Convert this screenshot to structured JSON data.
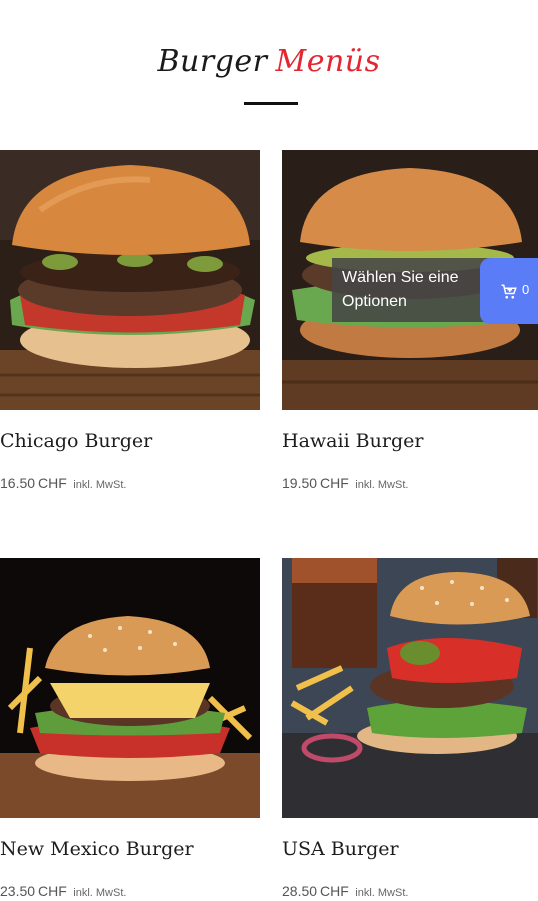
{
  "heading": {
    "part1": "Burger",
    "part2": "Menüs"
  },
  "products": [
    {
      "name": "Chicago Burger",
      "price": "16.50",
      "currency": "CHF",
      "tax_note": "inkl. MwSt."
    },
    {
      "name": "Hawaii Burger",
      "price": "19.50",
      "currency": "CHF",
      "tax_note": "inkl. MwSt."
    },
    {
      "name": "New Mexico Burger",
      "price": "23.50",
      "currency": "CHF",
      "tax_note": "inkl. MwSt."
    },
    {
      "name": "USA Burger",
      "price": "28.50",
      "currency": "CHF",
      "tax_note": "inkl. MwSt."
    }
  ],
  "tooltip": {
    "text": "Wählen Sie eine Optionen"
  },
  "cart": {
    "count": "0",
    "icon": "cart-icon"
  },
  "colors": {
    "accent_red": "#e3262f",
    "cart_blue": "#5a7cf6"
  }
}
